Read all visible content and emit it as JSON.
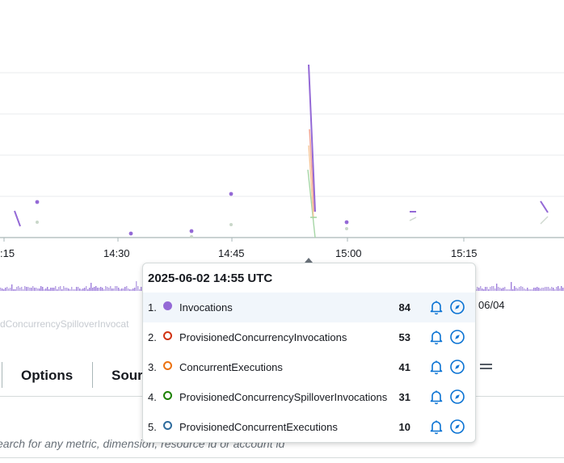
{
  "chart": {
    "x_ticks": [
      ":15",
      "14:30",
      "14:45",
      "15:00",
      "15:15"
    ],
    "date_label": "06/04",
    "legend_fragment": "dConcurrencySpilloverInvocat",
    "colors": {
      "invocations": "#8c4fff",
      "provisioned_invocations": "#d13212",
      "concurrent_executions": "#ec7211",
      "spillover": "#2ea44f",
      "provisioned_concurrent": "#2e6c9e"
    }
  },
  "tooltip": {
    "title": "2025-06-02 14:55 UTC",
    "rows": [
      {
        "rank": "1.",
        "name": "Invocations",
        "value": "84",
        "color": "#9469d6",
        "filled": true,
        "bell_icon": "bell-icon",
        "explore_icon": "compass-icon"
      },
      {
        "rank": "2.",
        "name": "ProvisionedConcurrencyInvocations",
        "value": "53",
        "color": "#d13212",
        "filled": false,
        "bell_icon": "bell-icon",
        "explore_icon": "compass-icon"
      },
      {
        "rank": "3.",
        "name": "ConcurrentExecutions",
        "value": "41",
        "color": "#ec7211",
        "filled": false,
        "bell_icon": "bell-icon",
        "explore_icon": "compass-icon"
      },
      {
        "rank": "4.",
        "name": "ProvisionedConcurrencySpilloverInvocations",
        "value": "31",
        "color": "#1d8102",
        "filled": false,
        "bell_icon": "bell-icon",
        "explore_icon": "compass-icon"
      },
      {
        "rank": "5.",
        "name": "ProvisionedConcurrentExecutions",
        "value": "10",
        "color": "#2e6c9e",
        "filled": false,
        "bell_icon": "bell-icon",
        "explore_icon": "compass-icon"
      }
    ]
  },
  "tabs": {
    "options": "Options",
    "source": "Sour"
  },
  "search": {
    "placeholder": "earch for any metric, dimension, resource id or account id"
  }
}
